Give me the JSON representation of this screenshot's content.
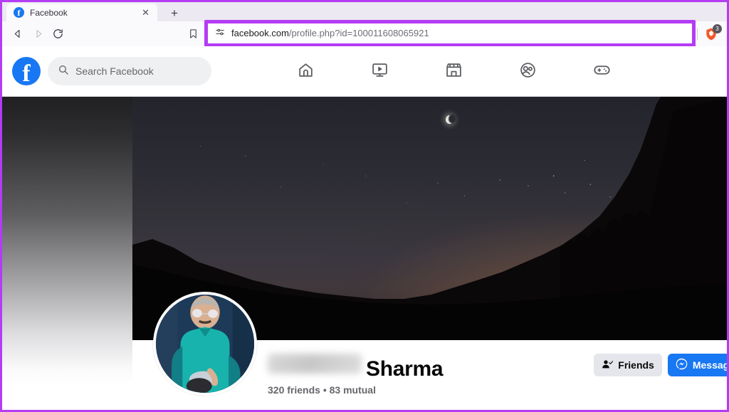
{
  "browser": {
    "tab": {
      "title": "Facebook",
      "favicon_icon": "facebook-favicon",
      "close_icon": "close-icon"
    },
    "new_tab_label": "+",
    "nav": {
      "back_icon": "back-arrow-icon",
      "forward_icon": "forward-arrow-icon",
      "reload_icon": "reload-icon",
      "bookmark_icon": "bookmark-icon"
    },
    "address_bar": {
      "site_settings_icon": "site-settings-icon",
      "url_host": "facebook.com",
      "url_path": "/profile.php?id=100011608065921",
      "url_full": "facebook.com/profile.php?id=100011608065921",
      "highlight_color": "#b43cf5"
    },
    "toolbar_right": {
      "cast_icon": "cast-icon",
      "share_icon": "share-icon",
      "shield_icon": "brave-shield-icon",
      "shield_badge": "3"
    }
  },
  "facebook": {
    "logo_icon": "facebook-logo-icon",
    "search": {
      "icon": "search-icon",
      "placeholder": "Search Facebook",
      "value": ""
    },
    "nav_items": [
      {
        "name": "home",
        "icon": "home-icon"
      },
      {
        "name": "video",
        "icon": "video-icon"
      },
      {
        "name": "marketplace",
        "icon": "marketplace-icon"
      },
      {
        "name": "groups",
        "icon": "groups-icon"
      },
      {
        "name": "gaming",
        "icon": "gaming-icon"
      }
    ]
  },
  "profile": {
    "cover_photo_alt": "night sky over mountain silhouette with crescent moon",
    "avatar_alt": "person in teal shirt",
    "name_first_blurred": "",
    "name_last": "Sharma",
    "friends_meta": "320 friends • 83 mutual",
    "buttons": {
      "friends_label": "Friends",
      "friends_icon": "friend-check-icon",
      "message_label": "Message",
      "message_icon": "messenger-icon"
    }
  },
  "colors": {
    "facebook_blue": "#1877f2",
    "highlight_purple": "#b43cf5",
    "button_gray": "#e4e6eb",
    "muted_text": "#65676b"
  }
}
